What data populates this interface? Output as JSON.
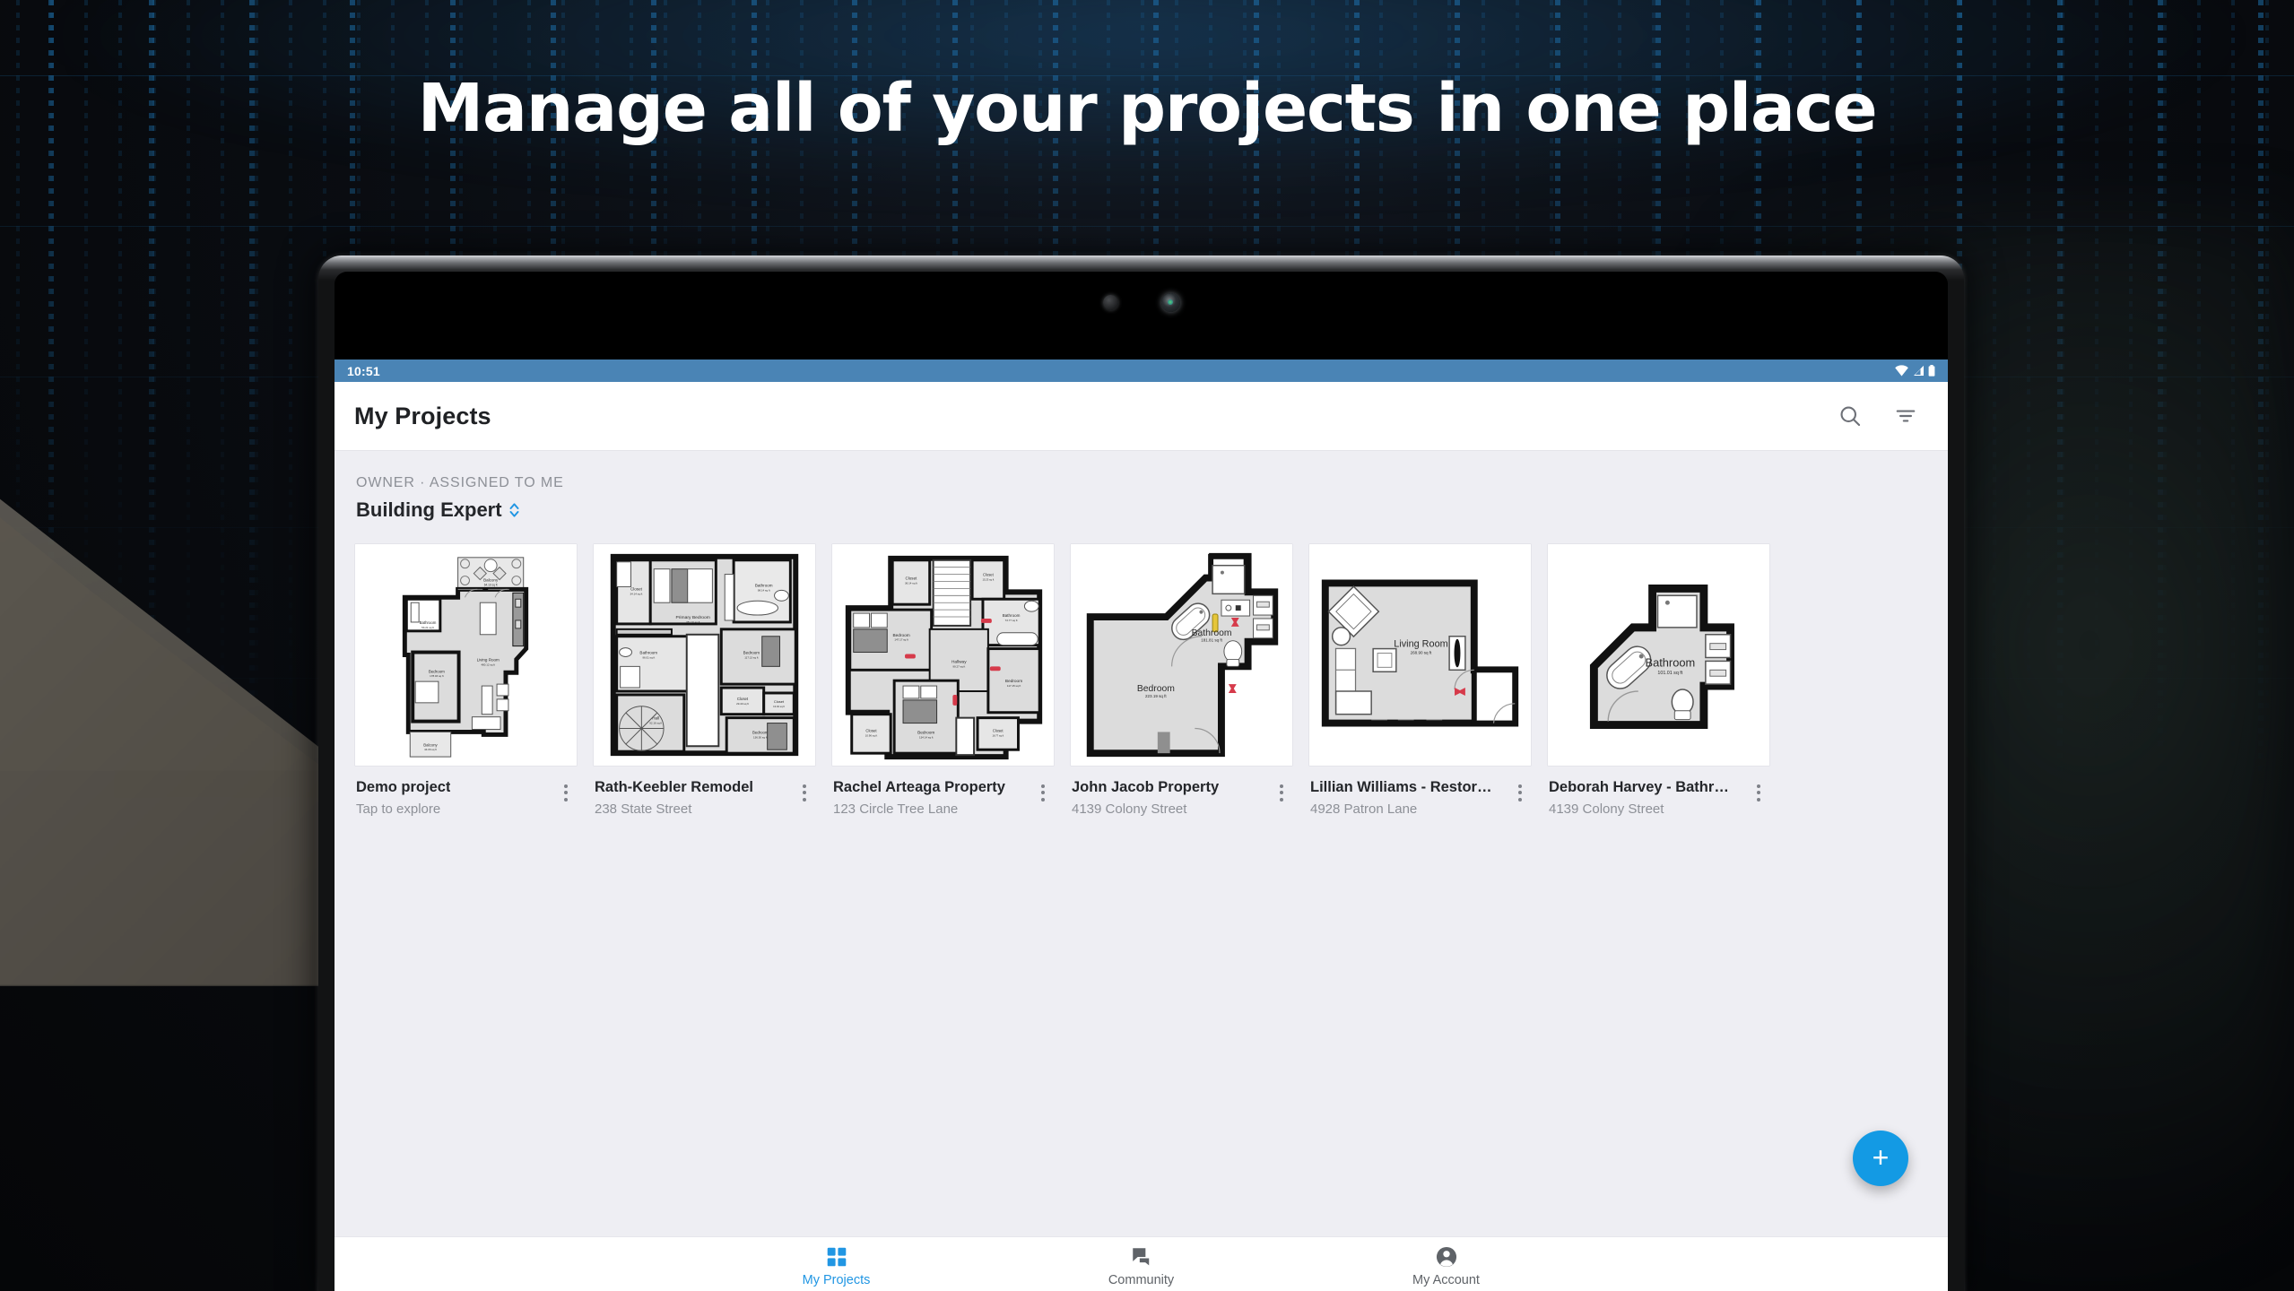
{
  "promo": {
    "headline": "Manage all of your projects in one place"
  },
  "device": {
    "status_bar": {
      "time": "10:51",
      "icons": [
        "wifi-icon",
        "signal-icon",
        "battery-icon"
      ]
    }
  },
  "app": {
    "appbar": {
      "title": "My Projects",
      "actions": [
        {
          "name": "search-icon",
          "label": "Search"
        },
        {
          "name": "filter-icon",
          "label": "Filter"
        }
      ]
    },
    "group": {
      "kicker": "OWNER · ASSIGNED TO ME",
      "title": "Building Expert",
      "selector_icon": "chevron-up-down-icon"
    },
    "projects": [
      {
        "title": "Demo project",
        "subtitle": "Tap to explore",
        "thumb": "floorplan-apartment",
        "rooms": [
          {
            "name": "Balcony",
            "area": "64.10 sq ft"
          },
          {
            "name": "Bathroom",
            "area": "53.21 sq ft"
          },
          {
            "name": "Living Room",
            "area": "480.12 sq ft"
          },
          {
            "name": "Bedroom",
            "area": "178.03 sq ft"
          },
          {
            "name": "Balcony",
            "area": "44.06 sq ft"
          }
        ]
      },
      {
        "title": "Rath-Keebler Remodel",
        "subtitle": "238 State Street",
        "thumb": "floorplan-upper-floor",
        "rooms": [
          {
            "name": "Closet",
            "area": "34.14 sq ft"
          },
          {
            "name": "Primary Bedroom",
            "area": "281.10 sq ft"
          },
          {
            "name": "Bathroom",
            "area": "98.14 sq ft"
          },
          {
            "name": "Bathroom",
            "area": "96.01 sq ft"
          },
          {
            "name": "Bedroom",
            "area": "117.13 sq ft"
          },
          {
            "name": "Closet",
            "area": "29.40 sq ft"
          },
          {
            "name": "Closet",
            "area": "13.04 sq ft"
          },
          {
            "name": "Hall",
            "area": "92.16 sq ft"
          },
          {
            "name": "Bedroom",
            "area": "136.50 sq ft"
          }
        ]
      },
      {
        "title": "Rachel Arteaga Property",
        "subtitle": "123 Circle Tree Lane",
        "thumb": "floorplan-bedrooms",
        "rooms": [
          {
            "name": "Closet",
            "area": "36.14 sq ft"
          },
          {
            "name": "Closet",
            "area": "15.23 sq ft"
          },
          {
            "name": "Bedroom",
            "area": "147.17 sq ft"
          },
          {
            "name": "Bathroom",
            "area": "72.77 sq ft"
          },
          {
            "name": "Hallway",
            "area": "99.27 sq ft"
          },
          {
            "name": "Bedroom",
            "area": "117.15 sq ft"
          },
          {
            "name": "Closet",
            "area": "10.96 sq ft"
          },
          {
            "name": "Bedroom",
            "area": "134.14 sq ft"
          },
          {
            "name": "Closet",
            "area": "16.77 sq ft"
          }
        ]
      },
      {
        "title": "John Jacob Property",
        "subtitle": "4139 Colony Street",
        "thumb": "floorplan-bed-bath",
        "rooms": [
          {
            "name": "Bathroom",
            "area": "181.81 sq ft"
          },
          {
            "name": "Bedroom",
            "area": "223.19 sq ft"
          }
        ]
      },
      {
        "title": "Lillian Williams - Restora…",
        "subtitle": "4928 Patron Lane",
        "thumb": "floorplan-living-room",
        "rooms": [
          {
            "name": "Living Room",
            "area": "268.90 sq ft"
          }
        ]
      },
      {
        "title": "Deborah Harvey - Bathro…",
        "subtitle": "4139 Colony Street",
        "thumb": "floorplan-bathroom",
        "rooms": [
          {
            "name": "Bathroom",
            "area": "101.01 sq ft"
          }
        ]
      }
    ],
    "fab": {
      "name": "add-project-fab",
      "glyph": "+"
    },
    "bottom_nav": [
      {
        "label": "My Projects",
        "icon": "grid-icon",
        "active": true
      },
      {
        "label": "Community",
        "icon": "chat-icon",
        "active": false
      },
      {
        "label": "My Account",
        "icon": "account-icon",
        "active": false
      }
    ]
  },
  "colors": {
    "accent": "#139ae4",
    "statusbar": "#4a84b5",
    "page_bg": "#eeeef3",
    "text_primary": "#24262a",
    "text_secondary": "#8d9097"
  }
}
